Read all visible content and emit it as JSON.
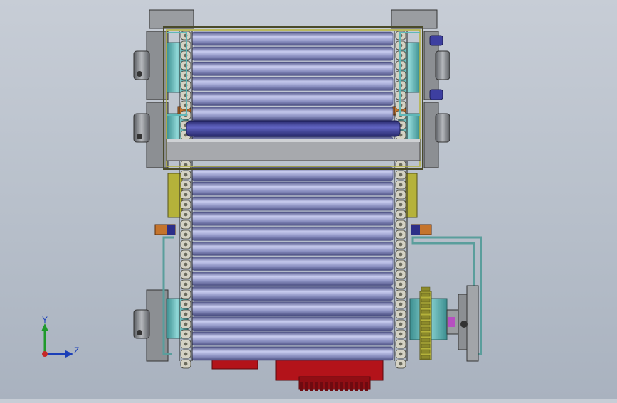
{
  "viewport": {
    "background_top": "#c7cdd6",
    "background_bottom": "#a9b2bf",
    "model": {
      "roller_count": 22,
      "colors": {
        "roller": "#8a8fc0",
        "roller_dark": "#4d5184",
        "roller_light": "#c9cdf0",
        "frame_gray": "#8f9296",
        "steel_light": "#c8cacd",
        "steel_dark": "#4a4d52",
        "cyan_block": "#5fb7b8",
        "olive_bracket": "#b5b23a",
        "red_motor": "#b3131a",
        "blue_shaft": "#3d3fa0",
        "orange_spacer": "#c5742c",
        "teal_guard": "#5a9e9c"
      }
    }
  },
  "triad": {
    "y_label": "Y",
    "z_label": "Z",
    "y_color": "#1f9a2a",
    "z_color": "#1b3fb8",
    "x_color": "#c62828"
  }
}
